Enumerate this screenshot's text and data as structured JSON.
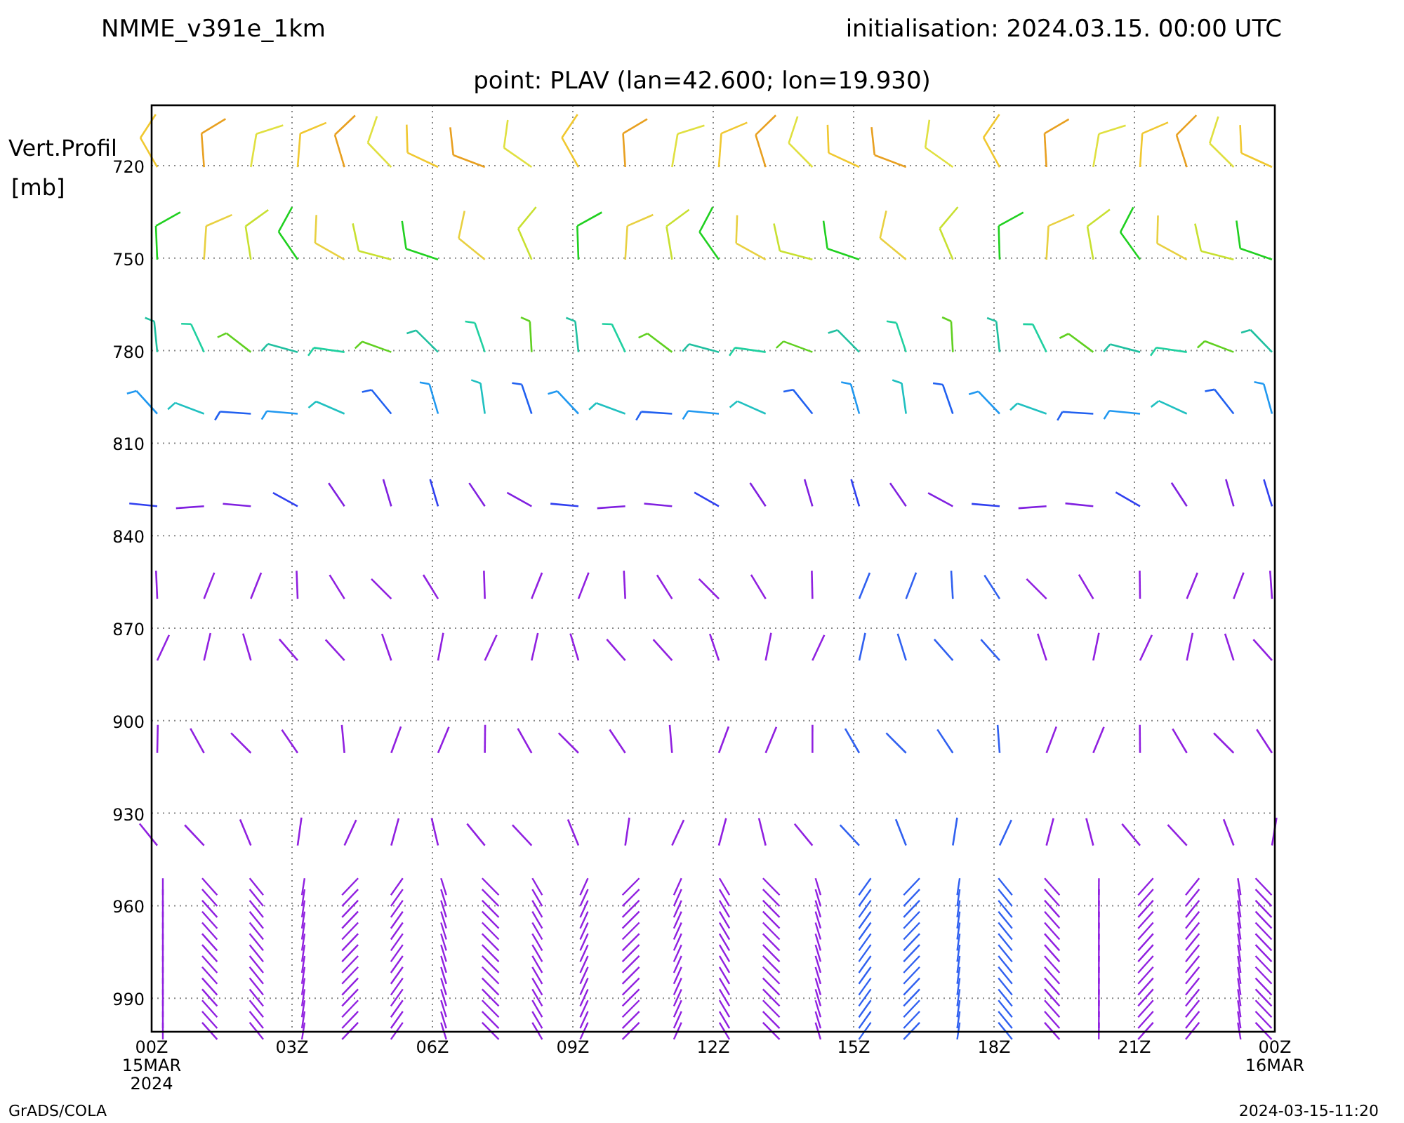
{
  "header": {
    "model": "NMME_v391e_1km",
    "initialisation": "initialisation: 2024.03.15. 00:00 UTC",
    "point": "point: PLAV (lan=42.600; lon=19.930)"
  },
  "y_axis": {
    "title": "Vert.Profil",
    "unit": "[mb]",
    "ticks": [
      "720",
      "750",
      "780",
      "810",
      "840",
      "870",
      "900",
      "930",
      "960",
      "990"
    ]
  },
  "x_axis": {
    "ticks": [
      [
        "00Z",
        "15MAR",
        "2024"
      ],
      [
        "03Z"
      ],
      [
        "06Z"
      ],
      [
        "09Z"
      ],
      [
        "12Z"
      ],
      [
        "15Z"
      ],
      [
        "18Z"
      ],
      [
        "21Z"
      ],
      [
        "00Z",
        "16MAR"
      ]
    ]
  },
  "footer": {
    "left": "GrADS/COLA",
    "right": "2024-03-15-11:20"
  }
}
